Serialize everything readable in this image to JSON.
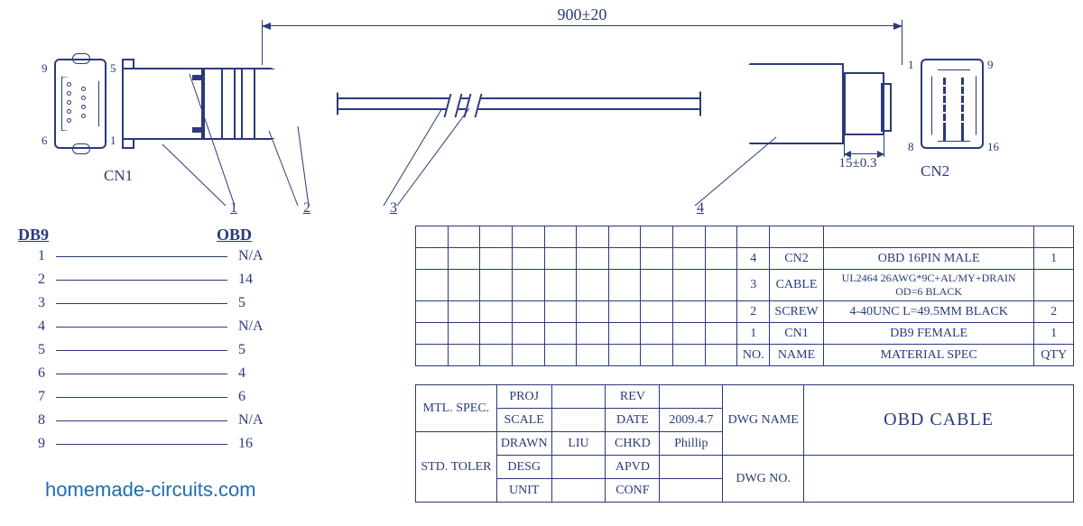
{
  "dimensions": {
    "overall_length": "900±20",
    "plug_depth": "15±0.3"
  },
  "connectors": {
    "cn1": {
      "label": "CN1",
      "front_pins": {
        "tl": "9",
        "tr": "5",
        "bl": "6",
        "br": "1"
      }
    },
    "cn2": {
      "label": "CN2",
      "front_pins": {
        "tl": "1",
        "tr": "9",
        "bl": "8",
        "br": "16"
      }
    }
  },
  "leaders": {
    "1": "1",
    "2": "2",
    "3": "3",
    "4": "4"
  },
  "pinmap": {
    "hdr_db9": "DB9",
    "hdr_obd": "OBD",
    "rows": [
      {
        "db9": "1",
        "obd": "N/A"
      },
      {
        "db9": "2",
        "obd": "14"
      },
      {
        "db9": "3",
        "obd": "5"
      },
      {
        "db9": "4",
        "obd": "N/A"
      },
      {
        "db9": "5",
        "obd": "5"
      },
      {
        "db9": "6",
        "obd": "4"
      },
      {
        "db9": "7",
        "obd": "6"
      },
      {
        "db9": "8",
        "obd": "N/A"
      },
      {
        "db9": "9",
        "obd": "16"
      }
    ]
  },
  "bom": {
    "hdr": {
      "no": "NO.",
      "name": "NAME",
      "spec": "MATERIAL SPEC",
      "qty": "QTY"
    },
    "rows": [
      {
        "no": "4",
        "name": "CN2",
        "spec": "OBD 16PIN MALE",
        "qty": "1"
      },
      {
        "no": "3",
        "name": "CABLE",
        "spec": "UL2464 26AWG*9C+AL/MY+DRAIN OD=6 BLACK",
        "qty": ""
      },
      {
        "no": "2",
        "name": "SCREW",
        "spec": "4-40UNC L=49.5MM BLACK",
        "qty": "2"
      },
      {
        "no": "1",
        "name": "CN1",
        "spec": "DB9 FEMALE",
        "qty": "1"
      }
    ]
  },
  "titleblock": {
    "labels": {
      "mtl_spec": "MTL. SPEC.",
      "proj": "PROJ",
      "rev": "REV",
      "scale": "SCALE",
      "date": "DATE",
      "drawn": "DRAWN",
      "chkd": "CHKD",
      "std_toler": "STD. TOLER",
      "desg": "DESG",
      "apvd": "APVD",
      "unit": "UNIT",
      "conf": "CONF",
      "dwg_name": "DWG NAME",
      "dwg_no": "DWG NO."
    },
    "values": {
      "date": "2009.4.7",
      "drawn": "LIU",
      "chkd": "Phillip",
      "dwg_name": "OBD CABLE"
    }
  },
  "watermark": "homemade-circuits.com"
}
